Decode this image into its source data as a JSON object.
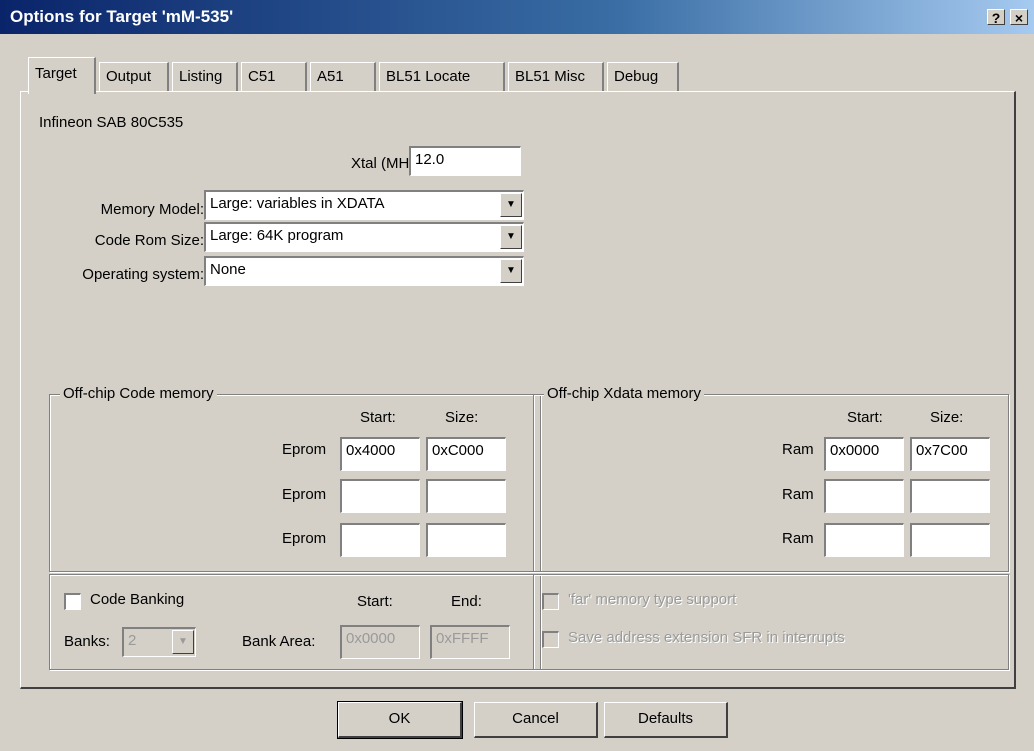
{
  "window": {
    "title": "Options for Target 'mM-535'",
    "help_btn": "?",
    "close_btn": "×"
  },
  "tabs": [
    "Target",
    "Output",
    "Listing",
    "C51",
    "A51",
    "BL51 Locate",
    "BL51 Misc",
    "Debug"
  ],
  "target": {
    "device": "Infineon SAB 80C535",
    "xtal_label": "Xtal (MHz):",
    "xtal_value": "12.0",
    "memory_model_label": "Memory Model:",
    "memory_model_value": "Large: variables in XDATA",
    "code_rom_label": "Code Rom Size:",
    "code_rom_value": "Large: 64K program",
    "os_label": "Operating system:",
    "os_value": "None"
  },
  "code_memory": {
    "legend": "Off-chip Code memory",
    "start_header": "Start:",
    "size_header": "Size:",
    "rows": [
      {
        "label": "Eprom",
        "start": "0x4000",
        "size": "0xC000"
      },
      {
        "label": "Eprom",
        "start": "",
        "size": ""
      },
      {
        "label": "Eprom",
        "start": "",
        "size": ""
      }
    ]
  },
  "xdata_memory": {
    "legend": "Off-chip Xdata memory",
    "start_header": "Start:",
    "size_header": "Size:",
    "rows": [
      {
        "label": "Ram",
        "start": "0x0000",
        "size": "0x7C00"
      },
      {
        "label": "Ram",
        "start": "",
        "size": ""
      },
      {
        "label": "Ram",
        "start": "",
        "size": ""
      }
    ]
  },
  "banking": {
    "code_banking_label": "Code Banking",
    "start_header": "Start:",
    "end_header": "End:",
    "banks_label": "Banks:",
    "banks_value": "2",
    "bank_area_label": "Bank Area:",
    "bank_start": "0x0000",
    "bank_end": "0xFFFF"
  },
  "far_options": {
    "far_memory_label": "'far' memory type support",
    "save_sfr_label": "Save address extension SFR in interrupts"
  },
  "buttons": {
    "ok": "OK",
    "cancel": "Cancel",
    "defaults": "Defaults"
  }
}
